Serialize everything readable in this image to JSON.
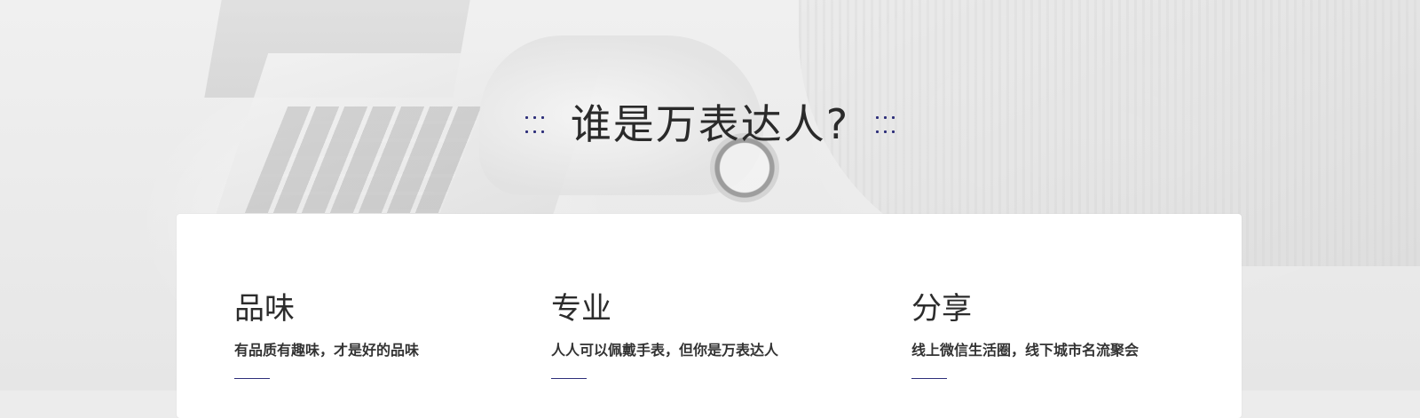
{
  "hero": {
    "title": "谁是万表达人?"
  },
  "features": [
    {
      "name": "品味",
      "desc": "有品质有趣味，才是好的品味"
    },
    {
      "name": "专业",
      "desc": "人人可以佩戴手表，但你是万表达人"
    },
    {
      "name": "分享",
      "desc": "线上微信生活圈，线下城市名流聚会"
    }
  ],
  "colors": {
    "accent": "#2e2f7a",
    "title_text": "#2a2a2a",
    "card_bg": "#ffffff"
  }
}
